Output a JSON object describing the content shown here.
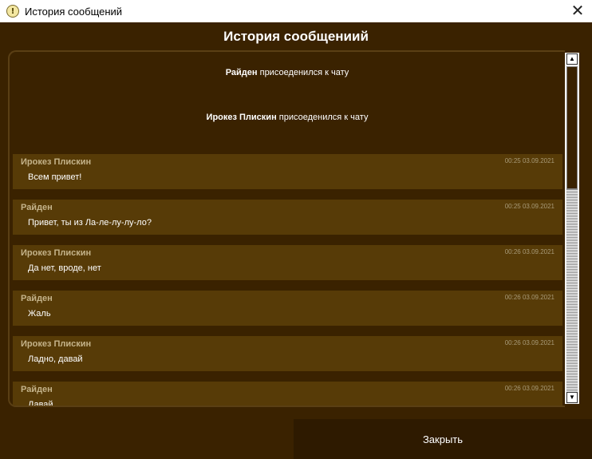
{
  "window": {
    "title": "История сообщений",
    "close_glyph": "✕",
    "app_icon_glyph": "!"
  },
  "header": {
    "title": "История сообщениий"
  },
  "system_messages": [
    {
      "name": "Райден",
      "text": "присоеденился к чату"
    },
    {
      "name": "Ирокез Плискин",
      "text": "присоеденился к чату"
    }
  ],
  "messages": [
    {
      "author": "Ирокез Плискин",
      "time": "00:25 03.09.2021",
      "text": "Всем привет!"
    },
    {
      "author": "Райден",
      "time": "00:25 03.09.2021",
      "text": "Привет, ты из Ла-ле-лу-лу-ло?"
    },
    {
      "author": "Ирокез Плискин",
      "time": "00:26 03.09.2021",
      "text": "Да нет, вроде, нет"
    },
    {
      "author": "Райден",
      "time": "00:26 03.09.2021",
      "text": "Жаль"
    },
    {
      "author": "Ирокез Плискин",
      "time": "00:26 03.09.2021",
      "text": "Ладно, давай"
    },
    {
      "author": "Райден",
      "time": "00:26 03.09.2021",
      "text": "Давай"
    }
  ],
  "footer": {
    "close_label": "Закрыть"
  },
  "scrollbar": {
    "up_glyph": "▲",
    "down_glyph": "▼"
  },
  "colors": {
    "background": "#3a2200",
    "message_bg": "#573b07",
    "author": "#c4b38a",
    "close_button_bg": "#2e1a00"
  }
}
